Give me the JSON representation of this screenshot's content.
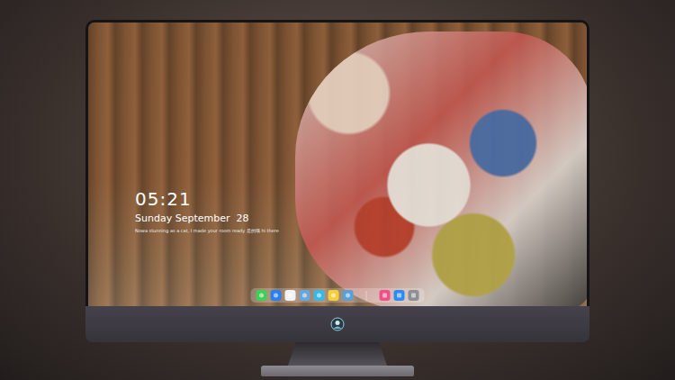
{
  "desktop": {
    "clock": "05:21",
    "date": "Sunday September  28",
    "note": "Nowa stunning as a cat, I made your room ready 是的哦 hi there"
  },
  "dock": {
    "pinned": [
      {
        "color": "#3ecf5a"
      },
      {
        "color": "#2f7fe8"
      },
      {
        "color": "#f2f2f2"
      },
      {
        "color": "#6aa6d8"
      },
      {
        "color": "#39b8e8"
      },
      {
        "color": "#f5cf3a"
      },
      {
        "color": "#5a9fd6"
      }
    ],
    "extras": [
      {
        "color": "#f0508a"
      },
      {
        "color": "#2e8cf0"
      },
      {
        "color": "#8e8e93"
      }
    ]
  }
}
